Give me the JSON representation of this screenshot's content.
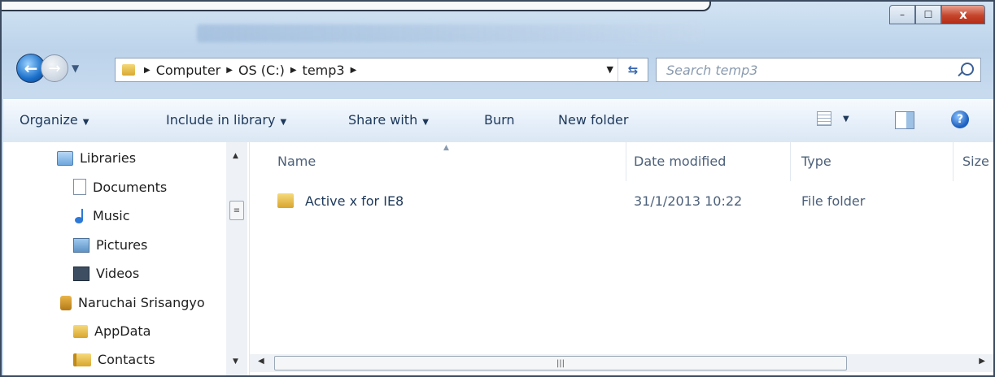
{
  "window": {
    "minimize": "–",
    "maximize": "☐",
    "close": "x"
  },
  "address": {
    "crumbs": [
      "Computer",
      "OS (C:)",
      "temp3"
    ],
    "search_placeholder": "Search temp3"
  },
  "toolbar": {
    "organize": "Organize",
    "include": "Include in library",
    "share": "Share with",
    "burn": "Burn",
    "new_folder": "New folder"
  },
  "nav": {
    "items": [
      {
        "label": "Libraries",
        "icon": "library-icon"
      },
      {
        "label": "Documents",
        "icon": "document-icon"
      },
      {
        "label": "Music",
        "icon": "music-icon"
      },
      {
        "label": "Pictures",
        "icon": "pictures-icon"
      },
      {
        "label": "Videos",
        "icon": "videos-icon"
      },
      {
        "label": "Naruchai Srisangyo",
        "icon": "user-folder-icon"
      },
      {
        "label": "AppData",
        "icon": "folder-icon"
      },
      {
        "label": "Contacts",
        "icon": "contacts-icon"
      }
    ]
  },
  "columns": {
    "name": "Name",
    "date": "Date modified",
    "type": "Type",
    "size": "Size"
  },
  "files": [
    {
      "name": "Active x for IE8",
      "date": "31/1/2013 10:22",
      "type": "File folder"
    }
  ]
}
